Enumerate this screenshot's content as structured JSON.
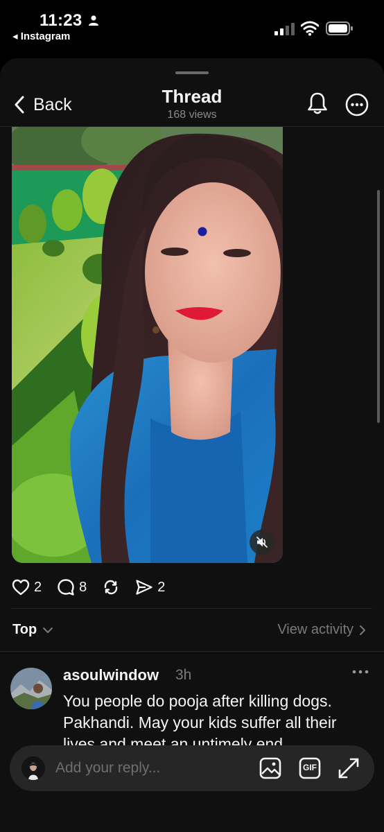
{
  "status_bar": {
    "time": "11:23",
    "back_app": "◂ Instagram",
    "icons": [
      "person-icon",
      "signal-icon",
      "wifi-icon",
      "battery-icon"
    ]
  },
  "header": {
    "back_label": "Back",
    "title": "Thread",
    "views": "168 views",
    "icons": [
      "chevron-left-icon",
      "bell-icon",
      "more-circle-icon"
    ]
  },
  "post": {
    "media_description_icon": "mute-icon",
    "likes": "2",
    "replies": "8",
    "shares": "2",
    "icons": [
      "heart-icon",
      "comment-icon",
      "repost-icon",
      "send-icon"
    ]
  },
  "sort": {
    "label": "Top",
    "view_activity": "View activity"
  },
  "reply": {
    "username": "asoulwindow",
    "time": "3h",
    "text": "You people do pooja after killing dogs. Pakhandi. May your kids suffer all their lives and meet an untimely end."
  },
  "composer": {
    "placeholder": "Add your reply...",
    "icons": [
      "image-icon",
      "gif-icon",
      "expand-icon"
    ],
    "gif_label": "GIF"
  },
  "colors": {
    "background": "#000000",
    "sheet": "#101010",
    "text": "#f3f5f7",
    "muted": "#7a7a7a",
    "composer": "#262626"
  }
}
